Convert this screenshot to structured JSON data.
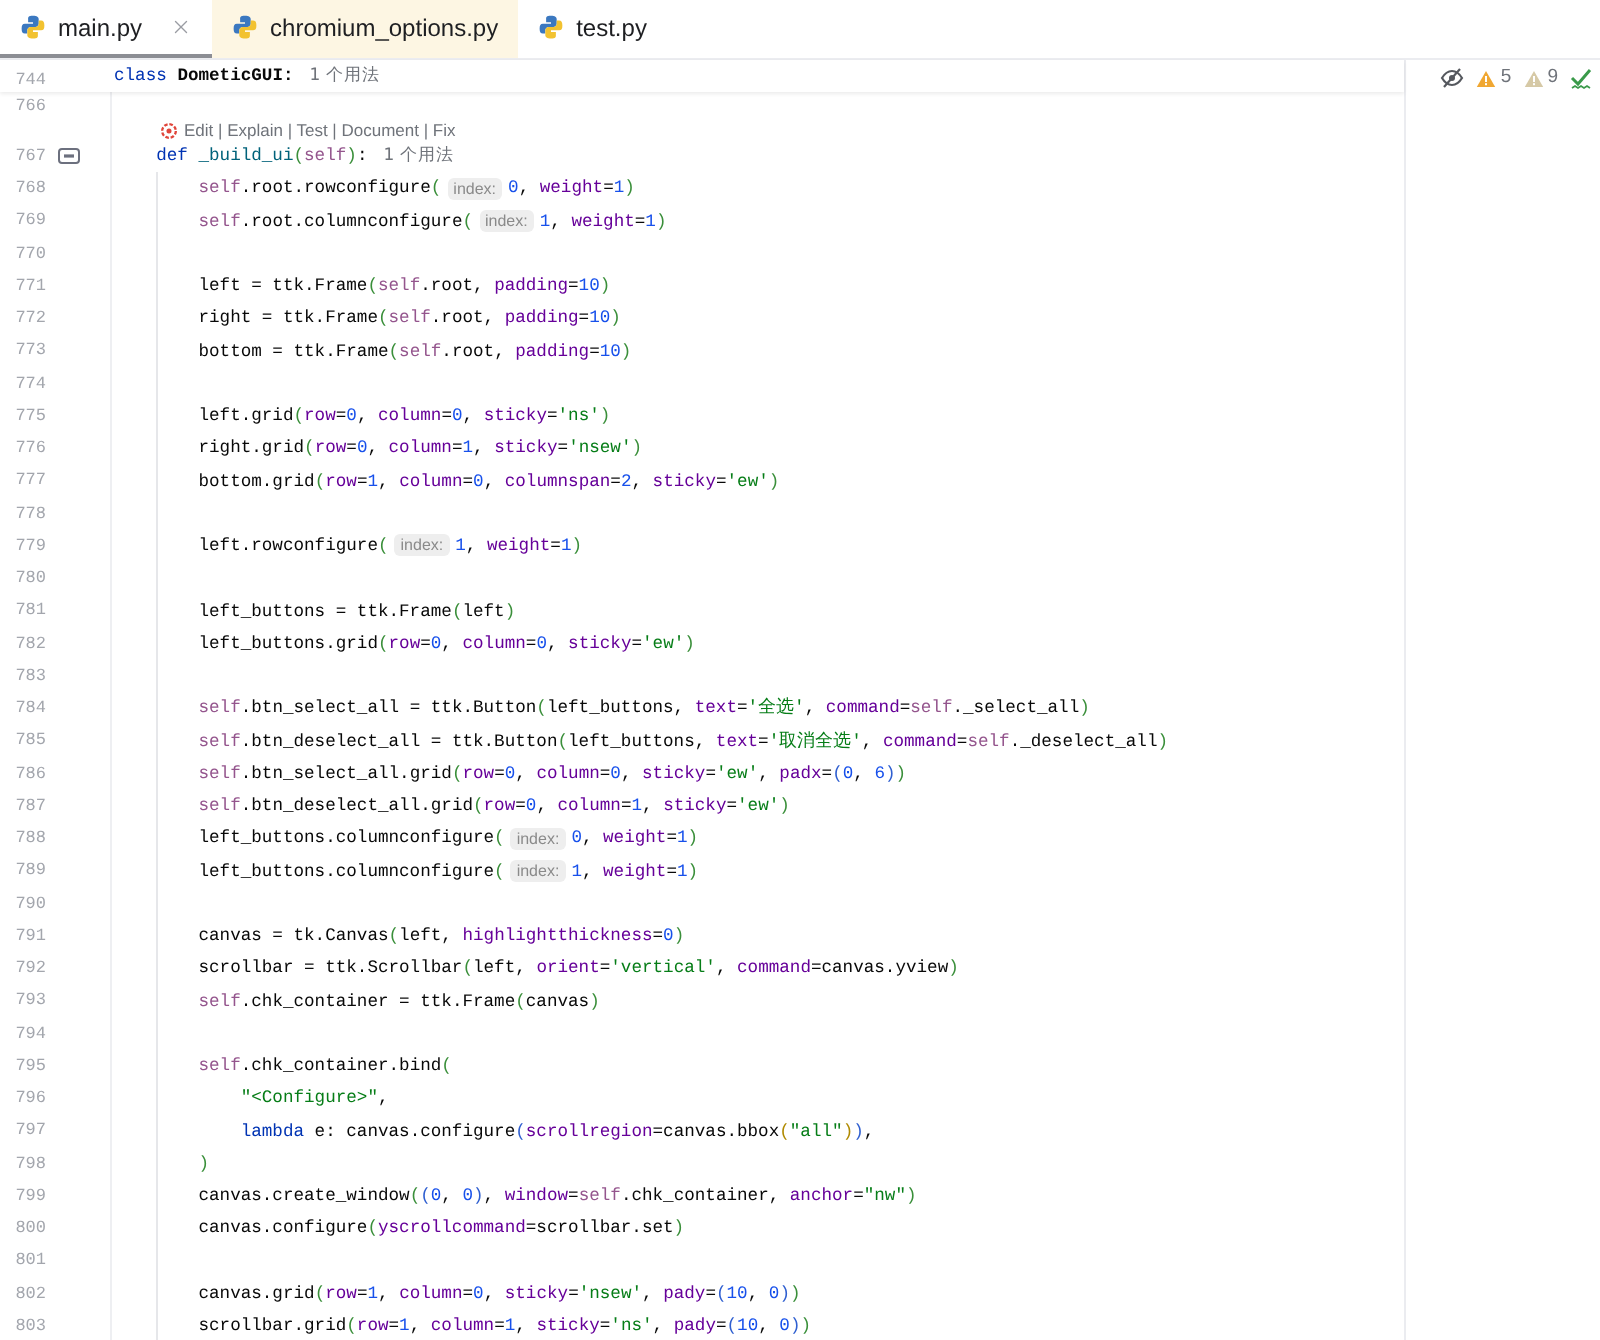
{
  "tabs": [
    {
      "label": "main.py",
      "selected": true,
      "highlighted": false
    },
    {
      "label": "chromium_options.py",
      "selected": false,
      "highlighted": true
    },
    {
      "label": "test.py",
      "selected": false,
      "highlighted": false
    }
  ],
  "sticky_line": {
    "number": "744",
    "tokens": [
      {
        "kind": "keyword",
        "text": "class "
      },
      {
        "kind": "classname",
        "text": "DometicGUI:"
      },
      {
        "kind": "usage",
        "text": "1 个用法"
      }
    ]
  },
  "inspections": [
    {
      "kind": "warning",
      "count": "5"
    },
    {
      "kind": "weak",
      "count": "9"
    }
  ],
  "lines": [
    {
      "kind": "code",
      "number": "766"
    },
    {
      "kind": "lens",
      "text": "Edit | Explain | Test | Document | Fix"
    },
    {
      "kind": "code",
      "number": "767",
      "marker": true,
      "tokens": [
        {
          "kind": "keyword",
          "text": "    def "
        },
        {
          "kind": "function",
          "text": "_build_ui"
        },
        {
          "kind": "paren1",
          "text": "("
        },
        {
          "kind": "self",
          "text": "self"
        },
        {
          "kind": "paren1",
          "text": ")"
        },
        {
          "kind": "plain",
          "text": ":"
        },
        {
          "kind": "usage",
          "text": "1 个用法"
        }
      ]
    },
    {
      "kind": "code",
      "number": "768",
      "tokens": [
        {
          "kind": "self",
          "text": "        self"
        },
        {
          "kind": "plain",
          "text": ".root.rowconfigure"
        },
        {
          "kind": "paren1",
          "text": "("
        },
        {
          "kind": "hint",
          "text": "index:"
        },
        {
          "kind": "number",
          "text": "0"
        },
        {
          "kind": "plain",
          "text": ", "
        },
        {
          "kind": "arg",
          "text": "weight"
        },
        {
          "kind": "plain",
          "text": "="
        },
        {
          "kind": "number",
          "text": "1"
        },
        {
          "kind": "paren1",
          "text": ")"
        }
      ]
    },
    {
      "kind": "code",
      "number": "769",
      "tokens": [
        {
          "kind": "self",
          "text": "        self"
        },
        {
          "kind": "plain",
          "text": ".root.columnconfigure"
        },
        {
          "kind": "paren1",
          "text": "("
        },
        {
          "kind": "hint",
          "text": "index:"
        },
        {
          "kind": "number",
          "text": "1"
        },
        {
          "kind": "plain",
          "text": ", "
        },
        {
          "kind": "arg",
          "text": "weight"
        },
        {
          "kind": "plain",
          "text": "="
        },
        {
          "kind": "number",
          "text": "1"
        },
        {
          "kind": "paren1",
          "text": ")"
        }
      ]
    },
    {
      "kind": "code",
      "number": "770"
    },
    {
      "kind": "code",
      "number": "771",
      "tokens": [
        {
          "kind": "plain",
          "text": "        left = ttk.Frame"
        },
        {
          "kind": "paren1",
          "text": "("
        },
        {
          "kind": "self",
          "text": "self"
        },
        {
          "kind": "plain",
          "text": ".root, "
        },
        {
          "kind": "arg",
          "text": "padding"
        },
        {
          "kind": "plain",
          "text": "="
        },
        {
          "kind": "number",
          "text": "10"
        },
        {
          "kind": "paren1",
          "text": ")"
        }
      ]
    },
    {
      "kind": "code",
      "number": "772",
      "tokens": [
        {
          "kind": "plain",
          "text": "        right = ttk.Frame"
        },
        {
          "kind": "paren1",
          "text": "("
        },
        {
          "kind": "self",
          "text": "self"
        },
        {
          "kind": "plain",
          "text": ".root, "
        },
        {
          "kind": "arg",
          "text": "padding"
        },
        {
          "kind": "plain",
          "text": "="
        },
        {
          "kind": "number",
          "text": "10"
        },
        {
          "kind": "paren1",
          "text": ")"
        }
      ]
    },
    {
      "kind": "code",
      "number": "773",
      "tokens": [
        {
          "kind": "plain",
          "text": "        bottom = ttk.Frame"
        },
        {
          "kind": "paren1",
          "text": "("
        },
        {
          "kind": "self",
          "text": "self"
        },
        {
          "kind": "plain",
          "text": ".root, "
        },
        {
          "kind": "arg",
          "text": "padding"
        },
        {
          "kind": "plain",
          "text": "="
        },
        {
          "kind": "number",
          "text": "10"
        },
        {
          "kind": "paren1",
          "text": ")"
        }
      ]
    },
    {
      "kind": "code",
      "number": "774"
    },
    {
      "kind": "code",
      "number": "775",
      "tokens": [
        {
          "kind": "plain",
          "text": "        left.grid"
        },
        {
          "kind": "paren1",
          "text": "("
        },
        {
          "kind": "arg",
          "text": "row"
        },
        {
          "kind": "plain",
          "text": "="
        },
        {
          "kind": "number",
          "text": "0"
        },
        {
          "kind": "plain",
          "text": ", "
        },
        {
          "kind": "arg",
          "text": "column"
        },
        {
          "kind": "plain",
          "text": "="
        },
        {
          "kind": "number",
          "text": "0"
        },
        {
          "kind": "plain",
          "text": ", "
        },
        {
          "kind": "arg",
          "text": "sticky"
        },
        {
          "kind": "plain",
          "text": "="
        },
        {
          "kind": "string",
          "text": "'ns'"
        },
        {
          "kind": "paren1",
          "text": ")"
        }
      ]
    },
    {
      "kind": "code",
      "number": "776",
      "tokens": [
        {
          "kind": "plain",
          "text": "        right.grid"
        },
        {
          "kind": "paren1",
          "text": "("
        },
        {
          "kind": "arg",
          "text": "row"
        },
        {
          "kind": "plain",
          "text": "="
        },
        {
          "kind": "number",
          "text": "0"
        },
        {
          "kind": "plain",
          "text": ", "
        },
        {
          "kind": "arg",
          "text": "column"
        },
        {
          "kind": "plain",
          "text": "="
        },
        {
          "kind": "number",
          "text": "1"
        },
        {
          "kind": "plain",
          "text": ", "
        },
        {
          "kind": "arg",
          "text": "sticky"
        },
        {
          "kind": "plain",
          "text": "="
        },
        {
          "kind": "string",
          "text": "'nsew'"
        },
        {
          "kind": "paren1",
          "text": ")"
        }
      ]
    },
    {
      "kind": "code",
      "number": "777",
      "tokens": [
        {
          "kind": "plain",
          "text": "        bottom.grid"
        },
        {
          "kind": "paren1",
          "text": "("
        },
        {
          "kind": "arg",
          "text": "row"
        },
        {
          "kind": "plain",
          "text": "="
        },
        {
          "kind": "number",
          "text": "1"
        },
        {
          "kind": "plain",
          "text": ", "
        },
        {
          "kind": "arg",
          "text": "column"
        },
        {
          "kind": "plain",
          "text": "="
        },
        {
          "kind": "number",
          "text": "0"
        },
        {
          "kind": "plain",
          "text": ", "
        },
        {
          "kind": "arg",
          "text": "columnspan"
        },
        {
          "kind": "plain",
          "text": "="
        },
        {
          "kind": "number",
          "text": "2"
        },
        {
          "kind": "plain",
          "text": ", "
        },
        {
          "kind": "arg",
          "text": "sticky"
        },
        {
          "kind": "plain",
          "text": "="
        },
        {
          "kind": "string",
          "text": "'ew'"
        },
        {
          "kind": "paren1",
          "text": ")"
        }
      ]
    },
    {
      "kind": "code",
      "number": "778"
    },
    {
      "kind": "code",
      "number": "779",
      "tokens": [
        {
          "kind": "plain",
          "text": "        left.rowconfigure"
        },
        {
          "kind": "paren1",
          "text": "("
        },
        {
          "kind": "hint",
          "text": "index:"
        },
        {
          "kind": "number",
          "text": "1"
        },
        {
          "kind": "plain",
          "text": ", "
        },
        {
          "kind": "arg",
          "text": "weight"
        },
        {
          "kind": "plain",
          "text": "="
        },
        {
          "kind": "number",
          "text": "1"
        },
        {
          "kind": "paren1",
          "text": ")"
        }
      ]
    },
    {
      "kind": "code",
      "number": "780"
    },
    {
      "kind": "code",
      "number": "781",
      "tokens": [
        {
          "kind": "plain",
          "text": "        left_buttons = ttk.Frame"
        },
        {
          "kind": "paren1",
          "text": "("
        },
        {
          "kind": "plain",
          "text": "left"
        },
        {
          "kind": "paren1",
          "text": ")"
        }
      ]
    },
    {
      "kind": "code",
      "number": "782",
      "tokens": [
        {
          "kind": "plain",
          "text": "        left_buttons.grid"
        },
        {
          "kind": "paren1",
          "text": "("
        },
        {
          "kind": "arg",
          "text": "row"
        },
        {
          "kind": "plain",
          "text": "="
        },
        {
          "kind": "number",
          "text": "0"
        },
        {
          "kind": "plain",
          "text": ", "
        },
        {
          "kind": "arg",
          "text": "column"
        },
        {
          "kind": "plain",
          "text": "="
        },
        {
          "kind": "number",
          "text": "0"
        },
        {
          "kind": "plain",
          "text": ", "
        },
        {
          "kind": "arg",
          "text": "sticky"
        },
        {
          "kind": "plain",
          "text": "="
        },
        {
          "kind": "string",
          "text": "'ew'"
        },
        {
          "kind": "paren1",
          "text": ")"
        }
      ]
    },
    {
      "kind": "code",
      "number": "783"
    },
    {
      "kind": "code",
      "number": "784",
      "tokens": [
        {
          "kind": "self",
          "text": "        self"
        },
        {
          "kind": "plain",
          "text": ".btn_select_all = ttk.Button"
        },
        {
          "kind": "paren1",
          "text": "("
        },
        {
          "kind": "plain",
          "text": "left_buttons, "
        },
        {
          "kind": "arg",
          "text": "text"
        },
        {
          "kind": "plain",
          "text": "="
        },
        {
          "kind": "string",
          "text": "'全选'"
        },
        {
          "kind": "plain",
          "text": ", "
        },
        {
          "kind": "arg",
          "text": "command"
        },
        {
          "kind": "plain",
          "text": "="
        },
        {
          "kind": "self",
          "text": "self"
        },
        {
          "kind": "plain",
          "text": "._select_all"
        },
        {
          "kind": "paren1",
          "text": ")"
        }
      ]
    },
    {
      "kind": "code",
      "number": "785",
      "tokens": [
        {
          "kind": "self",
          "text": "        self"
        },
        {
          "kind": "plain",
          "text": ".btn_deselect_all = ttk.Button"
        },
        {
          "kind": "paren1",
          "text": "("
        },
        {
          "kind": "plain",
          "text": "left_buttons, "
        },
        {
          "kind": "arg",
          "text": "text"
        },
        {
          "kind": "plain",
          "text": "="
        },
        {
          "kind": "string",
          "text": "'取消全选'"
        },
        {
          "kind": "plain",
          "text": ", "
        },
        {
          "kind": "arg",
          "text": "command"
        },
        {
          "kind": "plain",
          "text": "="
        },
        {
          "kind": "self",
          "text": "self"
        },
        {
          "kind": "plain",
          "text": "._deselect_all"
        },
        {
          "kind": "paren1",
          "text": ")"
        }
      ]
    },
    {
      "kind": "code",
      "number": "786",
      "tokens": [
        {
          "kind": "self",
          "text": "        self"
        },
        {
          "kind": "plain",
          "text": ".btn_select_all.grid"
        },
        {
          "kind": "paren1",
          "text": "("
        },
        {
          "kind": "arg",
          "text": "row"
        },
        {
          "kind": "plain",
          "text": "="
        },
        {
          "kind": "number",
          "text": "0"
        },
        {
          "kind": "plain",
          "text": ", "
        },
        {
          "kind": "arg",
          "text": "column"
        },
        {
          "kind": "plain",
          "text": "="
        },
        {
          "kind": "number",
          "text": "0"
        },
        {
          "kind": "plain",
          "text": ", "
        },
        {
          "kind": "arg",
          "text": "sticky"
        },
        {
          "kind": "plain",
          "text": "="
        },
        {
          "kind": "string",
          "text": "'ew'"
        },
        {
          "kind": "plain",
          "text": ", "
        },
        {
          "kind": "arg",
          "text": "padx"
        },
        {
          "kind": "plain",
          "text": "="
        },
        {
          "kind": "paren2",
          "text": "("
        },
        {
          "kind": "number",
          "text": "0"
        },
        {
          "kind": "plain",
          "text": ", "
        },
        {
          "kind": "number",
          "text": "6"
        },
        {
          "kind": "paren2",
          "text": ")"
        },
        {
          "kind": "paren1",
          "text": ")"
        }
      ]
    },
    {
      "kind": "code",
      "number": "787",
      "tokens": [
        {
          "kind": "self",
          "text": "        self"
        },
        {
          "kind": "plain",
          "text": ".btn_deselect_all.grid"
        },
        {
          "kind": "paren1",
          "text": "("
        },
        {
          "kind": "arg",
          "text": "row"
        },
        {
          "kind": "plain",
          "text": "="
        },
        {
          "kind": "number",
          "text": "0"
        },
        {
          "kind": "plain",
          "text": ", "
        },
        {
          "kind": "arg",
          "text": "column"
        },
        {
          "kind": "plain",
          "text": "="
        },
        {
          "kind": "number",
          "text": "1"
        },
        {
          "kind": "plain",
          "text": ", "
        },
        {
          "kind": "arg",
          "text": "sticky"
        },
        {
          "kind": "plain",
          "text": "="
        },
        {
          "kind": "string",
          "text": "'ew'"
        },
        {
          "kind": "paren1",
          "text": ")"
        }
      ]
    },
    {
      "kind": "code",
      "number": "788",
      "tokens": [
        {
          "kind": "plain",
          "text": "        left_buttons.columnconfigure"
        },
        {
          "kind": "paren1",
          "text": "("
        },
        {
          "kind": "hint",
          "text": "index:"
        },
        {
          "kind": "number",
          "text": "0"
        },
        {
          "kind": "plain",
          "text": ", "
        },
        {
          "kind": "arg",
          "text": "weight"
        },
        {
          "kind": "plain",
          "text": "="
        },
        {
          "kind": "number",
          "text": "1"
        },
        {
          "kind": "paren1",
          "text": ")"
        }
      ]
    },
    {
      "kind": "code",
      "number": "789",
      "tokens": [
        {
          "kind": "plain",
          "text": "        left_buttons.columnconfigure"
        },
        {
          "kind": "paren1",
          "text": "("
        },
        {
          "kind": "hint",
          "text": "index:"
        },
        {
          "kind": "number",
          "text": "1"
        },
        {
          "kind": "plain",
          "text": ", "
        },
        {
          "kind": "arg",
          "text": "weight"
        },
        {
          "kind": "plain",
          "text": "="
        },
        {
          "kind": "number",
          "text": "1"
        },
        {
          "kind": "paren1",
          "text": ")"
        }
      ]
    },
    {
      "kind": "code",
      "number": "790"
    },
    {
      "kind": "code",
      "number": "791",
      "tokens": [
        {
          "kind": "plain",
          "text": "        canvas = tk.Canvas"
        },
        {
          "kind": "paren1",
          "text": "("
        },
        {
          "kind": "plain",
          "text": "left, "
        },
        {
          "kind": "arg",
          "text": "highlightthickness"
        },
        {
          "kind": "plain",
          "text": "="
        },
        {
          "kind": "number",
          "text": "0"
        },
        {
          "kind": "paren1",
          "text": ")"
        }
      ]
    },
    {
      "kind": "code",
      "number": "792",
      "tokens": [
        {
          "kind": "plain",
          "text": "        scrollbar = ttk.Scrollbar"
        },
        {
          "kind": "paren1",
          "text": "("
        },
        {
          "kind": "plain",
          "text": "left, "
        },
        {
          "kind": "arg",
          "text": "orient"
        },
        {
          "kind": "plain",
          "text": "="
        },
        {
          "kind": "string",
          "text": "'vertical'"
        },
        {
          "kind": "plain",
          "text": ", "
        },
        {
          "kind": "arg",
          "text": "command"
        },
        {
          "kind": "plain",
          "text": "=canvas.yview"
        },
        {
          "kind": "paren1",
          "text": ")"
        }
      ]
    },
    {
      "kind": "code",
      "number": "793",
      "tokens": [
        {
          "kind": "self",
          "text": "        self"
        },
        {
          "kind": "plain",
          "text": ".chk_container = ttk.Frame"
        },
        {
          "kind": "paren1",
          "text": "("
        },
        {
          "kind": "plain",
          "text": "canvas"
        },
        {
          "kind": "paren1",
          "text": ")"
        }
      ]
    },
    {
      "kind": "code",
      "number": "794"
    },
    {
      "kind": "code",
      "number": "795",
      "tokens": [
        {
          "kind": "self",
          "text": "        self"
        },
        {
          "kind": "plain",
          "text": ".chk_container.bind"
        },
        {
          "kind": "paren1",
          "text": "("
        }
      ]
    },
    {
      "kind": "code",
      "number": "796",
      "tokens": [
        {
          "kind": "string",
          "text": "            \"<Configure>\""
        },
        {
          "kind": "plain",
          "text": ","
        }
      ]
    },
    {
      "kind": "code",
      "number": "797",
      "tokens": [
        {
          "kind": "keyword",
          "text": "            lambda"
        },
        {
          "kind": "plain",
          "text": " e: canvas.configure"
        },
        {
          "kind": "paren2",
          "text": "("
        },
        {
          "kind": "arg",
          "text": "scrollregion"
        },
        {
          "kind": "plain",
          "text": "=canvas.bbox"
        },
        {
          "kind": "paren3",
          "text": "("
        },
        {
          "kind": "string",
          "text": "\"all\""
        },
        {
          "kind": "paren3",
          "text": ")"
        },
        {
          "kind": "paren2",
          "text": ")"
        },
        {
          "kind": "plain",
          "text": ","
        }
      ]
    },
    {
      "kind": "code",
      "number": "798",
      "tokens": [
        {
          "kind": "paren1",
          "text": "        )"
        }
      ]
    },
    {
      "kind": "code",
      "number": "799",
      "tokens": [
        {
          "kind": "plain",
          "text": "        canvas.create_window"
        },
        {
          "kind": "paren1",
          "text": "("
        },
        {
          "kind": "paren2",
          "text": "("
        },
        {
          "kind": "number",
          "text": "0"
        },
        {
          "kind": "plain",
          "text": ", "
        },
        {
          "kind": "number",
          "text": "0"
        },
        {
          "kind": "paren2",
          "text": ")"
        },
        {
          "kind": "plain",
          "text": ", "
        },
        {
          "kind": "arg",
          "text": "window"
        },
        {
          "kind": "plain",
          "text": "="
        },
        {
          "kind": "self",
          "text": "self"
        },
        {
          "kind": "plain",
          "text": ".chk_container, "
        },
        {
          "kind": "arg",
          "text": "anchor"
        },
        {
          "kind": "plain",
          "text": "="
        },
        {
          "kind": "string",
          "text": "\"nw\""
        },
        {
          "kind": "paren1",
          "text": ")"
        }
      ]
    },
    {
      "kind": "code",
      "number": "800",
      "tokens": [
        {
          "kind": "plain",
          "text": "        canvas.configure"
        },
        {
          "kind": "paren1",
          "text": "("
        },
        {
          "kind": "arg",
          "text": "yscrollcommand"
        },
        {
          "kind": "plain",
          "text": "=scrollbar.set"
        },
        {
          "kind": "paren1",
          "text": ")"
        }
      ]
    },
    {
      "kind": "code",
      "number": "801"
    },
    {
      "kind": "code",
      "number": "802",
      "tokens": [
        {
          "kind": "plain",
          "text": "        canvas.grid"
        },
        {
          "kind": "paren1",
          "text": "("
        },
        {
          "kind": "arg",
          "text": "row"
        },
        {
          "kind": "plain",
          "text": "="
        },
        {
          "kind": "number",
          "text": "1"
        },
        {
          "kind": "plain",
          "text": ", "
        },
        {
          "kind": "arg",
          "text": "column"
        },
        {
          "kind": "plain",
          "text": "="
        },
        {
          "kind": "number",
          "text": "0"
        },
        {
          "kind": "plain",
          "text": ", "
        },
        {
          "kind": "arg",
          "text": "sticky"
        },
        {
          "kind": "plain",
          "text": "="
        },
        {
          "kind": "string",
          "text": "'nsew'"
        },
        {
          "kind": "plain",
          "text": ", "
        },
        {
          "kind": "arg",
          "text": "pady"
        },
        {
          "kind": "plain",
          "text": "="
        },
        {
          "kind": "paren2",
          "text": "("
        },
        {
          "kind": "number",
          "text": "10"
        },
        {
          "kind": "plain",
          "text": ", "
        },
        {
          "kind": "number",
          "text": "0"
        },
        {
          "kind": "paren2",
          "text": ")"
        },
        {
          "kind": "paren1",
          "text": ")"
        }
      ]
    },
    {
      "kind": "code",
      "number": "803",
      "tokens": [
        {
          "kind": "plain",
          "text": "        scrollbar.grid"
        },
        {
          "kind": "paren1",
          "text": "("
        },
        {
          "kind": "arg",
          "text": "row"
        },
        {
          "kind": "plain",
          "text": "="
        },
        {
          "kind": "number",
          "text": "1"
        },
        {
          "kind": "plain",
          "text": ", "
        },
        {
          "kind": "arg",
          "text": "column"
        },
        {
          "kind": "plain",
          "text": "="
        },
        {
          "kind": "number",
          "text": "1"
        },
        {
          "kind": "plain",
          "text": ", "
        },
        {
          "kind": "arg",
          "text": "sticky"
        },
        {
          "kind": "plain",
          "text": "="
        },
        {
          "kind": "string",
          "text": "'ns'"
        },
        {
          "kind": "plain",
          "text": ", "
        },
        {
          "kind": "arg",
          "text": "pady"
        },
        {
          "kind": "plain",
          "text": "="
        },
        {
          "kind": "paren2",
          "text": "("
        },
        {
          "kind": "number",
          "text": "10"
        },
        {
          "kind": "plain",
          "text": ", "
        },
        {
          "kind": "number",
          "text": "0"
        },
        {
          "kind": "paren2",
          "text": ")"
        },
        {
          "kind": "paren1",
          "text": ")"
        }
      ]
    }
  ]
}
